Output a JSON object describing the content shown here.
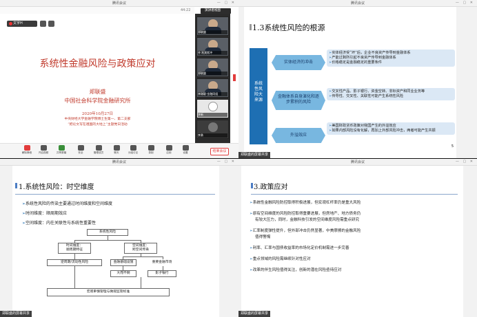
{
  "windows": {
    "w1": {
      "title": "腾讯会议",
      "top_time": "44:22",
      "view_label": "演讲者视图",
      "rec_label": "文字H",
      "slide": {
        "title": "系统性金融风险与政策应对",
        "author": "郑联盛",
        "org": "中国社会科学院金融研究所",
        "date": "2020年10月27日",
        "note1": "中央财经大学金融学院博士生第一、第二支部",
        "note2": "“把论文写在祖国的大地上”主题党日活动"
      },
      "gallery": [
        {
          "label": "郑联盛"
        },
        {
          "label": "齐 利莫斯冲"
        },
        {
          "label": "郑联盛"
        },
        {
          "label": "李刚聪·金融同组"
        },
        {
          "label": "李新"
        },
        {
          "label": "李勇"
        }
      ],
      "toolbar": [
        {
          "label": "解除静音"
        },
        {
          "label": "开启视频"
        },
        {
          "label": "共享屏幕"
        },
        {
          "label": "安全"
        },
        {
          "label": "管理成员"
        },
        {
          "label": "聊天"
        },
        {
          "label": "分组讨论"
        },
        {
          "label": "录制"
        },
        {
          "label": "应用"
        },
        {
          "label": "设置"
        }
      ],
      "leave_label": "结束会议"
    },
    "w2": {
      "title": "腾讯会议",
      "slide": {
        "title": "1.3系统性风险的根源",
        "vbox": [
          "系统",
          "性风",
          "险大",
          "来源"
        ],
        "rows": [
          {
            "label": "实体经济的冲击",
            "bullets": [
              "实体经济受“坏”后，企业不良资产传导到金融体系",
              "产能过剩所引起不良资产传导到金融体系",
              "价格稳定是金融稳定的重要条件"
            ]
          },
          {
            "label": "金融体系自身演化和逐步累积的风险",
            "bullets": [
              "交叉性产品、影子银行、资金空转、非标资产和同业业务等",
              "传导性、交叉性、关联性可能产生系统性风险"
            ]
          },
          {
            "label": "外溢效应",
            "bullets": [
              "美国财政货币政策对我国产生的外溢效应",
              "如果内部风险没有化解，再加上外部风险冲击，两者可能产生共振"
            ]
          }
        ],
        "page": "5"
      },
      "share_tag": "郑联盛的屏幕共享"
    },
    "w3": {
      "title": "腾讯会议",
      "slide": {
        "title": "1.系统性风险：时空维度",
        "items": [
          "系统性风险的传染主要通过时间维度和空间维度",
          "时间维度：顺周期效应",
          "空间维度：内在关联性与系统性重要性"
        ],
        "diagram": {
          "top": "系统性风险",
          "time": "时间维度：\n顺周期特征",
          "space": "空间维度：\n跨空间传染",
          "procyc": "逆周期/流动性风险",
          "infra": "金融基础设施",
          "market": "重要金融市场",
          "tbtf": "大而不倒",
          "shadow": "影子银行",
          "macro": "宏观审慎管理与微观监管标准"
        }
      },
      "share_tag": "郑联盛的屏幕共享"
    },
    "w4": {
      "title": "腾讯会议",
      "slide": {
        "title": "3.政策应对",
        "items": [
          {
            "text": "系统性金融风险防控取得积极进展，但宏观杠杆率仍是重大风险",
            "cont": ""
          },
          {
            "text": "原有空间维度的风险防控取得重要进展，但房地产、地方债务仍",
            "cont": "有较大压力，同时，金融科技引发的空间维度风险需重点研究"
          },
          {
            "text": "汇率制度弹性提升，但外部冲击仍然显著，中美摩擦的金融风险",
            "cont": "值得警惕"
          },
          {
            "text": "利率、汇率与国债收益率的市场化定价机制需进一步完善",
            "cont": ""
          },
          {
            "text": "重点领域的风险需继续针对性应对",
            "cont": ""
          },
          {
            "text": "改革的伴生风险值得关注，创新的潜在风险亟待应对",
            "cont": ""
          }
        ]
      },
      "share_tag": "郑联盛的屏幕共享"
    }
  },
  "colors": {
    "accent_blue": "#1e6fb3",
    "hex_blue": "#78b7e0",
    "bullet_bg": "#dbe8f5",
    "slide_red_title": "#c0392b",
    "leave_red": "#e23c3c"
  }
}
